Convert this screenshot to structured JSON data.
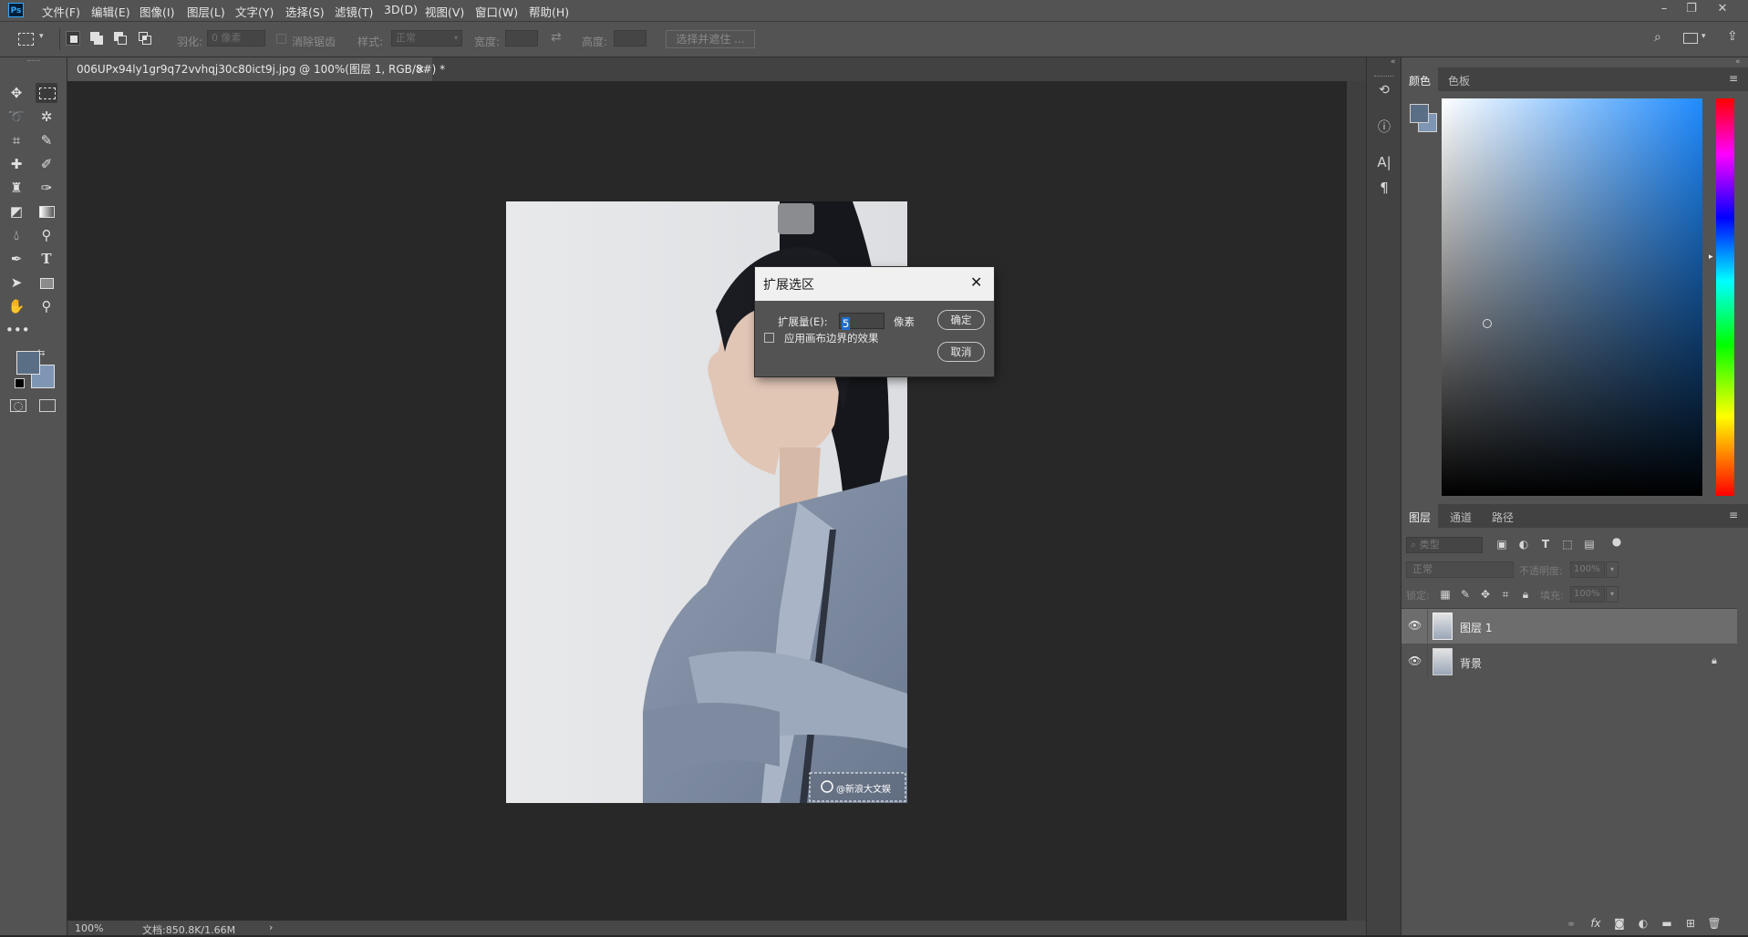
{
  "app": {
    "logo": "Ps"
  },
  "menu": [
    "文件(F)",
    "编辑(E)",
    "图像(I)",
    "图层(L)",
    "文字(Y)",
    "选择(S)",
    "滤镜(T)",
    "3D(D)",
    "视图(V)",
    "窗口(W)",
    "帮助(H)"
  ],
  "window_controls": {
    "minimize": "–",
    "restore": "❐",
    "close": "✕"
  },
  "options": {
    "feather_label": "羽化:",
    "feather_value": "0 像素",
    "antialias_label": "消除锯齿",
    "style_label": "样式:",
    "style_value": "正常",
    "width_label": "宽度:",
    "height_label": "高度:",
    "select_mask_button": "选择并遮住 ..."
  },
  "document": {
    "tab_title": "006UPx94ly1gr9q72vvhqj30c80ict9j.jpg @ 100%(图层 1, RGB/8#) *",
    "tab_close": "×",
    "zoom": "100%",
    "doc_info": "文档:850.8K/1.66M",
    "status_arrow": "›",
    "watermark": "@新浪大文娱"
  },
  "dialog": {
    "title": "扩展选区",
    "close": "✕",
    "expand_label": "扩展量(E):",
    "expand_value": "5",
    "unit": "像素",
    "canvas_bounds_label": "应用画布边界的效果",
    "canvas_bounds_checked": false,
    "ok": "确定",
    "cancel": "取消"
  },
  "color_panel": {
    "tabs": [
      "颜色",
      "色板"
    ],
    "active_tab": 0,
    "foreground_color": "#5a6e86",
    "background_color": "#7e96b4"
  },
  "layers_panel": {
    "tabs": [
      "图层",
      "通道",
      "路径"
    ],
    "active_tab": 0,
    "filter_kind": "类型",
    "blend_mode": "正常",
    "opacity_label": "不透明度:",
    "opacity_value": "100%",
    "lock_label": "锁定:",
    "fill_label": "填充:",
    "fill_value": "100%",
    "layers": [
      {
        "name": "图层 1",
        "selected": true,
        "locked": false
      },
      {
        "name": "背景",
        "selected": false,
        "locked": true
      }
    ]
  },
  "side_strip_icons": [
    "history-icon",
    "info-icon",
    "character-icon",
    "paragraph-icon"
  ]
}
